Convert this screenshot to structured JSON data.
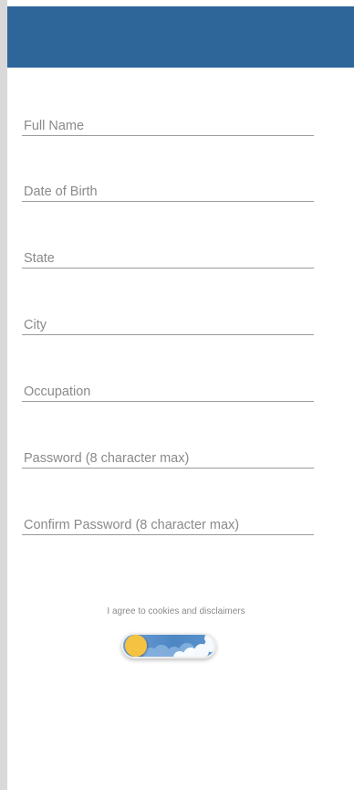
{
  "form": {
    "fields": [
      {
        "placeholder": "Full Name"
      },
      {
        "placeholder": "Date of Birth"
      },
      {
        "placeholder": "State"
      },
      {
        "placeholder": "City"
      },
      {
        "placeholder": "Occupation"
      },
      {
        "placeholder": "Password (8 character max)"
      },
      {
        "placeholder": "Confirm Password (8 character max)"
      }
    ],
    "agreement_label": "I agree to cookies and disclaimers",
    "agreement_toggle_state": "off"
  },
  "colors": {
    "header": "#2f669a",
    "toggle_sky": "#4e86c4",
    "sun": "#f5c242",
    "underline": "#9a9a9a"
  },
  "icons": {
    "toggle_knob": "sun-icon",
    "toggle_decoration": "cloud-icon"
  }
}
